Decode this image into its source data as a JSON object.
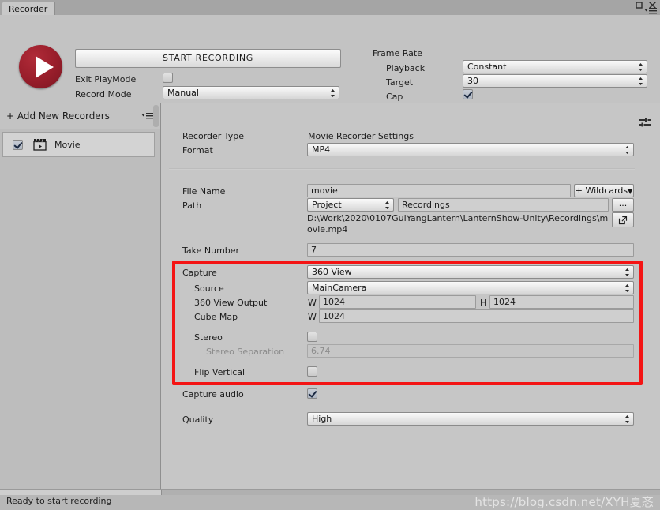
{
  "window": {
    "tab_label": "Recorder",
    "maximize_icon": "maximize-icon",
    "close_icon": "close-icon",
    "menu_icon": "window-menu-icon"
  },
  "record_controls": {
    "record_button_icon": "record-play-icon",
    "start_button_label": "START RECORDING",
    "exit_playmode_label": "Exit PlayMode",
    "exit_playmode_checked": false,
    "record_mode_label": "Record Mode",
    "record_mode_value": "Manual"
  },
  "frame_rate": {
    "group_label": "Frame Rate",
    "playback_label": "Playback",
    "playback_value": "Constant",
    "target_label": "Target",
    "target_value": "30",
    "cap_label": "Cap",
    "cap_checked": true
  },
  "sidebar": {
    "add_label": "+ Add New Recorders",
    "menu_icon": "list-options-icon",
    "items": [
      {
        "label": "Movie",
        "checked": true,
        "icon": "clapperboard-icon",
        "selected": true
      }
    ]
  },
  "settings": {
    "preset_icon": "preset-settings-icon",
    "recorder_type_label": "Recorder Type",
    "recorder_type_value": "Movie Recorder Settings",
    "format_label": "Format",
    "format_value": "MP4",
    "file_name_label": "File Name",
    "file_name_value": "movie",
    "wildcards_label": "+ Wildcards",
    "path_label": "Path",
    "path_root_value": "Project",
    "path_folder_value": "Recordings",
    "browse_label": "...",
    "open_folder_icon": "open-external-icon",
    "resolved_path": "D:\\Work\\2020\\0107GuiYangLantern\\LanternShow-Unity\\Recordings\\movie.mp4",
    "take_number_label": "Take Number",
    "take_number_value": "7",
    "capture_label": "Capture",
    "capture_value": "360 View",
    "source_label": "Source",
    "source_value": "MainCamera",
    "view_output_label": "360 View Output",
    "view_output_w_prefix": "W",
    "view_output_w_value": "1024",
    "view_output_h_prefix": "H",
    "view_output_h_value": "1024",
    "cube_map_label": "Cube Map",
    "cube_map_w_prefix": "W",
    "cube_map_w_value": "1024",
    "stereo_label": "Stereo",
    "stereo_checked": false,
    "stereo_separation_label": "Stereo Separation",
    "stereo_separation_value": "6.74",
    "flip_vertical_label": "Flip Vertical",
    "flip_vertical_checked": false,
    "capture_audio_label": "Capture audio",
    "capture_audio_checked": true,
    "quality_label": "Quality",
    "quality_value": "High"
  },
  "status": {
    "message": "Ready to start recording",
    "watermark": "https://blog.csdn.net/XYH夏忞"
  },
  "colors": {
    "highlight_box": "#f41414",
    "record_red": "#9b1f2c",
    "panel_bg": "#c3c3c3"
  }
}
